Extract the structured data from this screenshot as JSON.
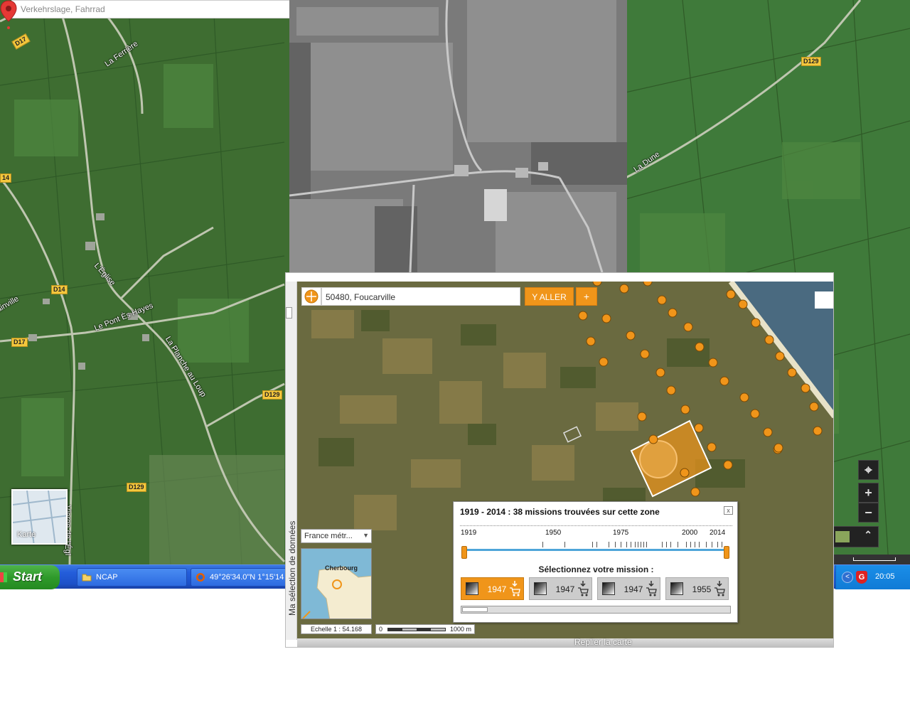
{
  "gmap": {
    "search_placeholder": "Verkehrslage, Fahrrad",
    "karte_label": "Karte",
    "labels": {
      "la_ferriere": "La Ferrière",
      "leglise": "L'Église",
      "le_pont_es_hayes": "Le Pont Ès Hayes",
      "la_planche_au_loup": "La Planche au Loup",
      "la_dune": "La Dune",
      "ainville": "ainville",
      "vierge": "Vierge de l'Égl"
    },
    "shields": {
      "d17_top": "D17",
      "d14_left": "14",
      "d14": "D14",
      "d17": "D17",
      "d129_a": "D129",
      "d129_b": "D129",
      "d129_c": "D129"
    },
    "controls": {
      "locate": "⌖",
      "zoom_in": "+",
      "zoom_out": "−",
      "expand": "⌃"
    }
  },
  "taskbar": {
    "start": "Start",
    "items": [
      {
        "label": "NCAP"
      },
      {
        "label": "49°26'34.0\"N 1°15'14"
      }
    ],
    "clock": "20:05",
    "colors": {
      "start": "#2f9a2b",
      "bar": "#245edb"
    }
  },
  "ign": {
    "search_value": "50480, Foucarville",
    "go_label": "Y ALLER",
    "plus_label": "+",
    "side_text": "Ma sélection de données",
    "region_select": "France métr...",
    "minimap_label": "Cherbourg",
    "scale_text": "Echelle 1 :  54.168",
    "scale_zero": "0",
    "scale_max": "1000 m",
    "fold_label": "Replier la carte",
    "accent": "#f0951a"
  },
  "mission": {
    "title": "1919 - 2014 : 38 missions trouvées sur cette zone",
    "close": "x",
    "years": [
      "1919",
      "1950",
      "1975",
      "2000",
      "2014"
    ],
    "select_label": "Sélectionnez votre mission :",
    "cards": [
      {
        "year": "1947",
        "selected": true
      },
      {
        "year": "1947",
        "selected": false
      },
      {
        "year": "1947",
        "selected": false
      },
      {
        "year": "1955",
        "selected": false
      }
    ]
  }
}
